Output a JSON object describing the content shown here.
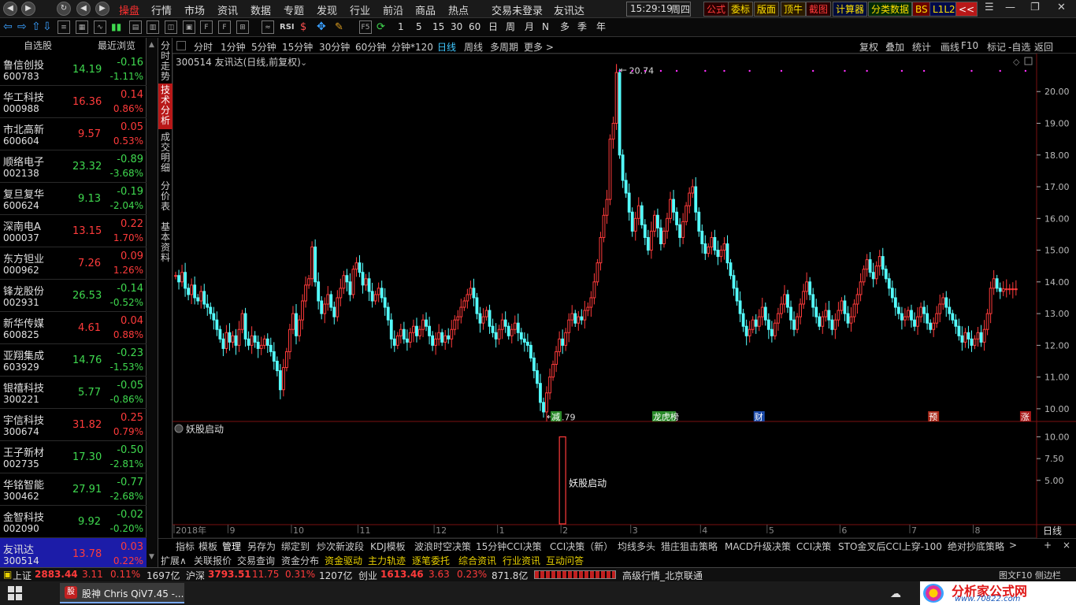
{
  "titlebar": {
    "nav_buttons": [
      "◀",
      "▶",
      "↻",
      "◀",
      "▶"
    ],
    "menus": [
      "操盘",
      "行情",
      "市场",
      "资讯",
      "数据",
      "专题",
      "发现",
      "行业",
      "前沿",
      "商品",
      "热点"
    ],
    "active_menu": "操盘",
    "login_status": "交易未登录",
    "stock_name": "友讯达",
    "clock": "15:29:19",
    "weekday": "周四",
    "right_buttons": [
      "公式",
      "委标",
      "版面",
      "顶牛",
      "截图",
      "计算器",
      "分类数据",
      "BS",
      "L1L2",
      "<<"
    ],
    "window_controls": [
      "☰",
      "—",
      "❐",
      "✕"
    ]
  },
  "toolbar": {
    "periods": [
      "1",
      "5",
      "15",
      "30",
      "60",
      "日",
      "周",
      "月",
      "N",
      "多",
      "季",
      "年"
    ],
    "rsi_label": "RSI",
    "f5_label": "F5"
  },
  "watchlist": {
    "headers": [
      "自选股",
      "最近浏览"
    ],
    "items": [
      {
        "name": "鲁信创投",
        "code": "600783",
        "price": "14.19",
        "change": "-0.16",
        "pct": "-1.11%",
        "dir": "dn"
      },
      {
        "name": "华工科技",
        "code": "000988",
        "price": "16.36",
        "change": "0.14",
        "pct": "0.86%",
        "dir": "up"
      },
      {
        "name": "市北高新",
        "code": "600604",
        "price": "9.57",
        "change": "0.05",
        "pct": "0.53%",
        "dir": "up"
      },
      {
        "name": "顺络电子",
        "code": "002138",
        "price": "23.32",
        "change": "-0.89",
        "pct": "-3.68%",
        "dir": "dn"
      },
      {
        "name": "复旦复华",
        "code": "600624",
        "price": "9.13",
        "change": "-0.19",
        "pct": "-2.04%",
        "dir": "dn"
      },
      {
        "name": "深南电A",
        "code": "000037",
        "price": "13.15",
        "change": "0.22",
        "pct": "1.70%",
        "dir": "up"
      },
      {
        "name": "东方钽业",
        "code": "000962",
        "price": "7.26",
        "change": "0.09",
        "pct": "1.26%",
        "dir": "up"
      },
      {
        "name": "锋龙股份",
        "code": "002931",
        "price": "26.53",
        "change": "-0.14",
        "pct": "-0.52%",
        "dir": "dn"
      },
      {
        "name": "新华传媒",
        "code": "600825",
        "price": "4.61",
        "change": "0.04",
        "pct": "0.88%",
        "dir": "up"
      },
      {
        "name": "亚翔集成",
        "code": "603929",
        "price": "14.76",
        "change": "-0.23",
        "pct": "-1.53%",
        "dir": "dn"
      },
      {
        "name": "银禧科技",
        "code": "300221",
        "price": "5.77",
        "change": "-0.05",
        "pct": "-0.86%",
        "dir": "dn"
      },
      {
        "name": "宇信科技",
        "code": "300674",
        "price": "31.82",
        "change": "0.25",
        "pct": "0.79%",
        "dir": "up"
      },
      {
        "name": "王子新材",
        "code": "002735",
        "price": "17.30",
        "change": "-0.50",
        "pct": "-2.81%",
        "dir": "dn"
      },
      {
        "name": "华铭智能",
        "code": "300462",
        "price": "27.91",
        "change": "-0.77",
        "pct": "-2.68%",
        "dir": "dn"
      },
      {
        "name": "金智科技",
        "code": "002090",
        "price": "9.92",
        "change": "-0.02",
        "pct": "-0.20%",
        "dir": "dn"
      },
      {
        "name": "友讯达",
        "code": "300514",
        "price": "13.78",
        "change": "0.03",
        "pct": "0.22%",
        "dir": "up",
        "selected": true
      }
    ]
  },
  "vtabs": [
    {
      "label": "分时走势",
      "active": false
    },
    {
      "label": "技术分析",
      "active": true
    },
    {
      "label": "成交明细",
      "active": false
    },
    {
      "label": "分价表",
      "active": false
    },
    {
      "label": "基本资料",
      "active": false
    }
  ],
  "periodbar": {
    "items": [
      "分时",
      "1分钟",
      "5分钟",
      "15分钟",
      "30分钟",
      "60分钟",
      "分钟*120",
      "日线",
      "周线",
      "多周期",
      "更多 >"
    ],
    "active": "日线",
    "right_items": [
      "复权",
      "叠加",
      "统计",
      "画线",
      "F10",
      "标记",
      "-自选",
      "返回"
    ]
  },
  "chart_header": {
    "title": "300514 友讯达(日线,前复权)",
    "indicator_name": "妖股启动"
  },
  "chart_data": [
    {
      "type": "candlestick",
      "title": "300514 友讯达(日线,前复权)",
      "ylim": [
        9.6,
        20.9
      ],
      "yticks": [
        10.0,
        11.0,
        12.0,
        13.0,
        14.0,
        15.0,
        16.0,
        17.0,
        18.0,
        19.0,
        20.0
      ],
      "ytick_labels": [
        "10.00",
        "11.00",
        "12.00",
        "13.00",
        "14.00",
        "15.00",
        "16.00",
        "17.00",
        "18.00",
        "19.00",
        "20.00"
      ],
      "high_label": "20.74",
      "low_label": "9.79",
      "high_value": 20.74,
      "low_value": 9.79,
      "x_labels": [
        "2018年",
        "9",
        "10",
        "11",
        "12",
        "1",
        "2",
        "3",
        "4",
        "5",
        "6",
        "7",
        "8"
      ],
      "x_label_index": [
        0,
        17,
        37,
        58,
        82,
        102,
        122,
        144,
        166,
        187,
        210,
        232,
        252
      ],
      "event_marks": [
        {
          "label": "减",
          "index": 120,
          "color": "#2a8a2a"
        },
        {
          "label": "龙虎榜",
          "index": 152,
          "color": "#2a8a2a"
        },
        {
          "label": "财",
          "index": 184,
          "color": "#1a4aaa"
        },
        {
          "label": "预",
          "index": 239,
          "color": "#aa2a1a"
        },
        {
          "label": "涨",
          "index": 268,
          "color": "#aa1a1a"
        }
      ],
      "n_bars": 272,
      "close": [
        14.2,
        14.0,
        14.3,
        13.8,
        13.6,
        13.9,
        13.5,
        13.4,
        13.7,
        13.3,
        13.2,
        13.0,
        12.8,
        12.5,
        12.2,
        11.9,
        12.4,
        12.1,
        12.3,
        12.0,
        12.5,
        13.0,
        12.2,
        12.0,
        12.3,
        12.1,
        11.9,
        12.0,
        12.2,
        12.0,
        11.8,
        11.5,
        11.2,
        10.6,
        11.3,
        11.8,
        12.5,
        13.0,
        12.3,
        12.8,
        13.4,
        13.9,
        14.1,
        15.1,
        14.0,
        13.4,
        13.0,
        13.3,
        13.6,
        13.2,
        12.9,
        13.5,
        13.8,
        14.2,
        14.0,
        13.6,
        14.4,
        14.6,
        14.3,
        13.9,
        14.1,
        13.7,
        13.4,
        13.6,
        13.8,
        13.5,
        13.2,
        12.8,
        12.2,
        12.0,
        12.3,
        12.5,
        12.2,
        12.1,
        12.4,
        12.6,
        12.3,
        12.5,
        12.8,
        12.6,
        12.3,
        12.0,
        12.2,
        12.4,
        12.1,
        12.3,
        12.2,
        12.5,
        12.8,
        12.9,
        13.2,
        13.4,
        13.6,
        13.8,
        13.5,
        13.0,
        12.7,
        12.9,
        13.1,
        12.6,
        12.4,
        12.2,
        12.5,
        12.8,
        12.6,
        12.3,
        12.5,
        12.7,
        12.4,
        12.2,
        12.1,
        12.0,
        11.6,
        11.2,
        10.8,
        10.2,
        9.9,
        10.5,
        11.0,
        11.4,
        11.8,
        12.2,
        12.0,
        12.4,
        12.8,
        13.0,
        12.7,
        12.9,
        12.8,
        13.1,
        13.2,
        13.5,
        14.0,
        14.6,
        15.4,
        16.1,
        16.6,
        18.5,
        19.0,
        20.6,
        18.0,
        17.2,
        16.8,
        16.2,
        15.6,
        16.0,
        16.4,
        15.8,
        15.4,
        15.0,
        15.6,
        16.1,
        15.7,
        15.2,
        15.6,
        16.0,
        16.6,
        16.2,
        15.8,
        15.4,
        15.9,
        16.4,
        16.8,
        17.0,
        16.2,
        15.6,
        15.2,
        14.9,
        15.1,
        15.4,
        15.0,
        14.8,
        15.0,
        15.2,
        14.6,
        14.2,
        13.8,
        13.4,
        13.0,
        12.6,
        12.3,
        12.5,
        12.8,
        12.6,
        12.9,
        13.2,
        12.8,
        12.5,
        12.3,
        12.7,
        13.0,
        13.3,
        13.6,
        13.2,
        12.8,
        12.5,
        12.9,
        13.3,
        13.7,
        14.0,
        13.6,
        13.2,
        12.9,
        12.6,
        12.9,
        13.1,
        12.8,
        12.5,
        12.8,
        13.1,
        13.4,
        13.0,
        12.7,
        12.9,
        13.3,
        13.6,
        14.0,
        14.4,
        14.7,
        14.3,
        14.1,
        14.5,
        14.8,
        14.4,
        14.1,
        13.8,
        13.5,
        13.2,
        13.0,
        12.8,
        12.9,
        13.1,
        12.8,
        12.6,
        12.9,
        13.2,
        13.0,
        12.7,
        12.5,
        12.7,
        13.0,
        13.3,
        13.5,
        13.2,
        13.0,
        12.8,
        12.6,
        12.3,
        12.1,
        12.4,
        12.2,
        12.0,
        12.2,
        12.4,
        12.1,
        12.5,
        13.0,
        13.8,
        14.1,
        13.8,
        13.7,
        13.78,
        13.78,
        13.78,
        13.78,
        13.78
      ]
    },
    {
      "type": "bar",
      "title": "妖股启动",
      "ylim": [
        0,
        11.5
      ],
      "yticks": [
        5.0,
        7.5,
        10.0
      ],
      "ytick_labels": [
        "5.00",
        "7.50",
        "10.00"
      ],
      "signal_index": 122,
      "signal_value": 10.0,
      "signal_label": "妖股启动"
    }
  ],
  "bottom_tabs_1": [
    "指标",
    "模板",
    "管理",
    "另存为",
    "绑定到",
    "炒次新波段",
    "KDJ模板",
    "波浪时空决策",
    "15分钟CCI决策",
    "CCI决策（新）",
    "均线多头",
    "猎庄狙击策略",
    "MACD升级决策",
    "CCI决策",
    "STO金叉后CCI上穿-100",
    "绝对抄底策略",
    ">",
    "+",
    "×"
  ],
  "bottom_tabs_2": [
    "扩展∧",
    "关联报价",
    "交易查询",
    "资金分布",
    "资金驱动",
    "主力轨迹",
    "逐笔委托",
    "综合资讯",
    "行业资讯",
    "互动问答"
  ],
  "status": {
    "sh_label": "上证",
    "sh_value": "2883.44",
    "sh_change": "3.11",
    "sh_pct": "0.11%",
    "sh_amount": "1697亿",
    "sz_label": "沪深",
    "sz_value": "3793.51",
    "sz_change": "11.75",
    "sz_pct": "0.31%",
    "sz_amount": "1207亿",
    "cy_label": "创业",
    "cy_value": "1613.46",
    "cy_change": "3.63",
    "cy_pct": "0.23%",
    "cy_amount": "871.8亿",
    "feed": "高级行情_北京联通",
    "f10_hint": "图文F10 侧边栏"
  },
  "taskbar": {
    "app_title": "股神 Chris QiV7.45 -...",
    "watermark": "分析家公式网",
    "watermark_url": "www.70822.com"
  },
  "date_axis_last": "日线"
}
